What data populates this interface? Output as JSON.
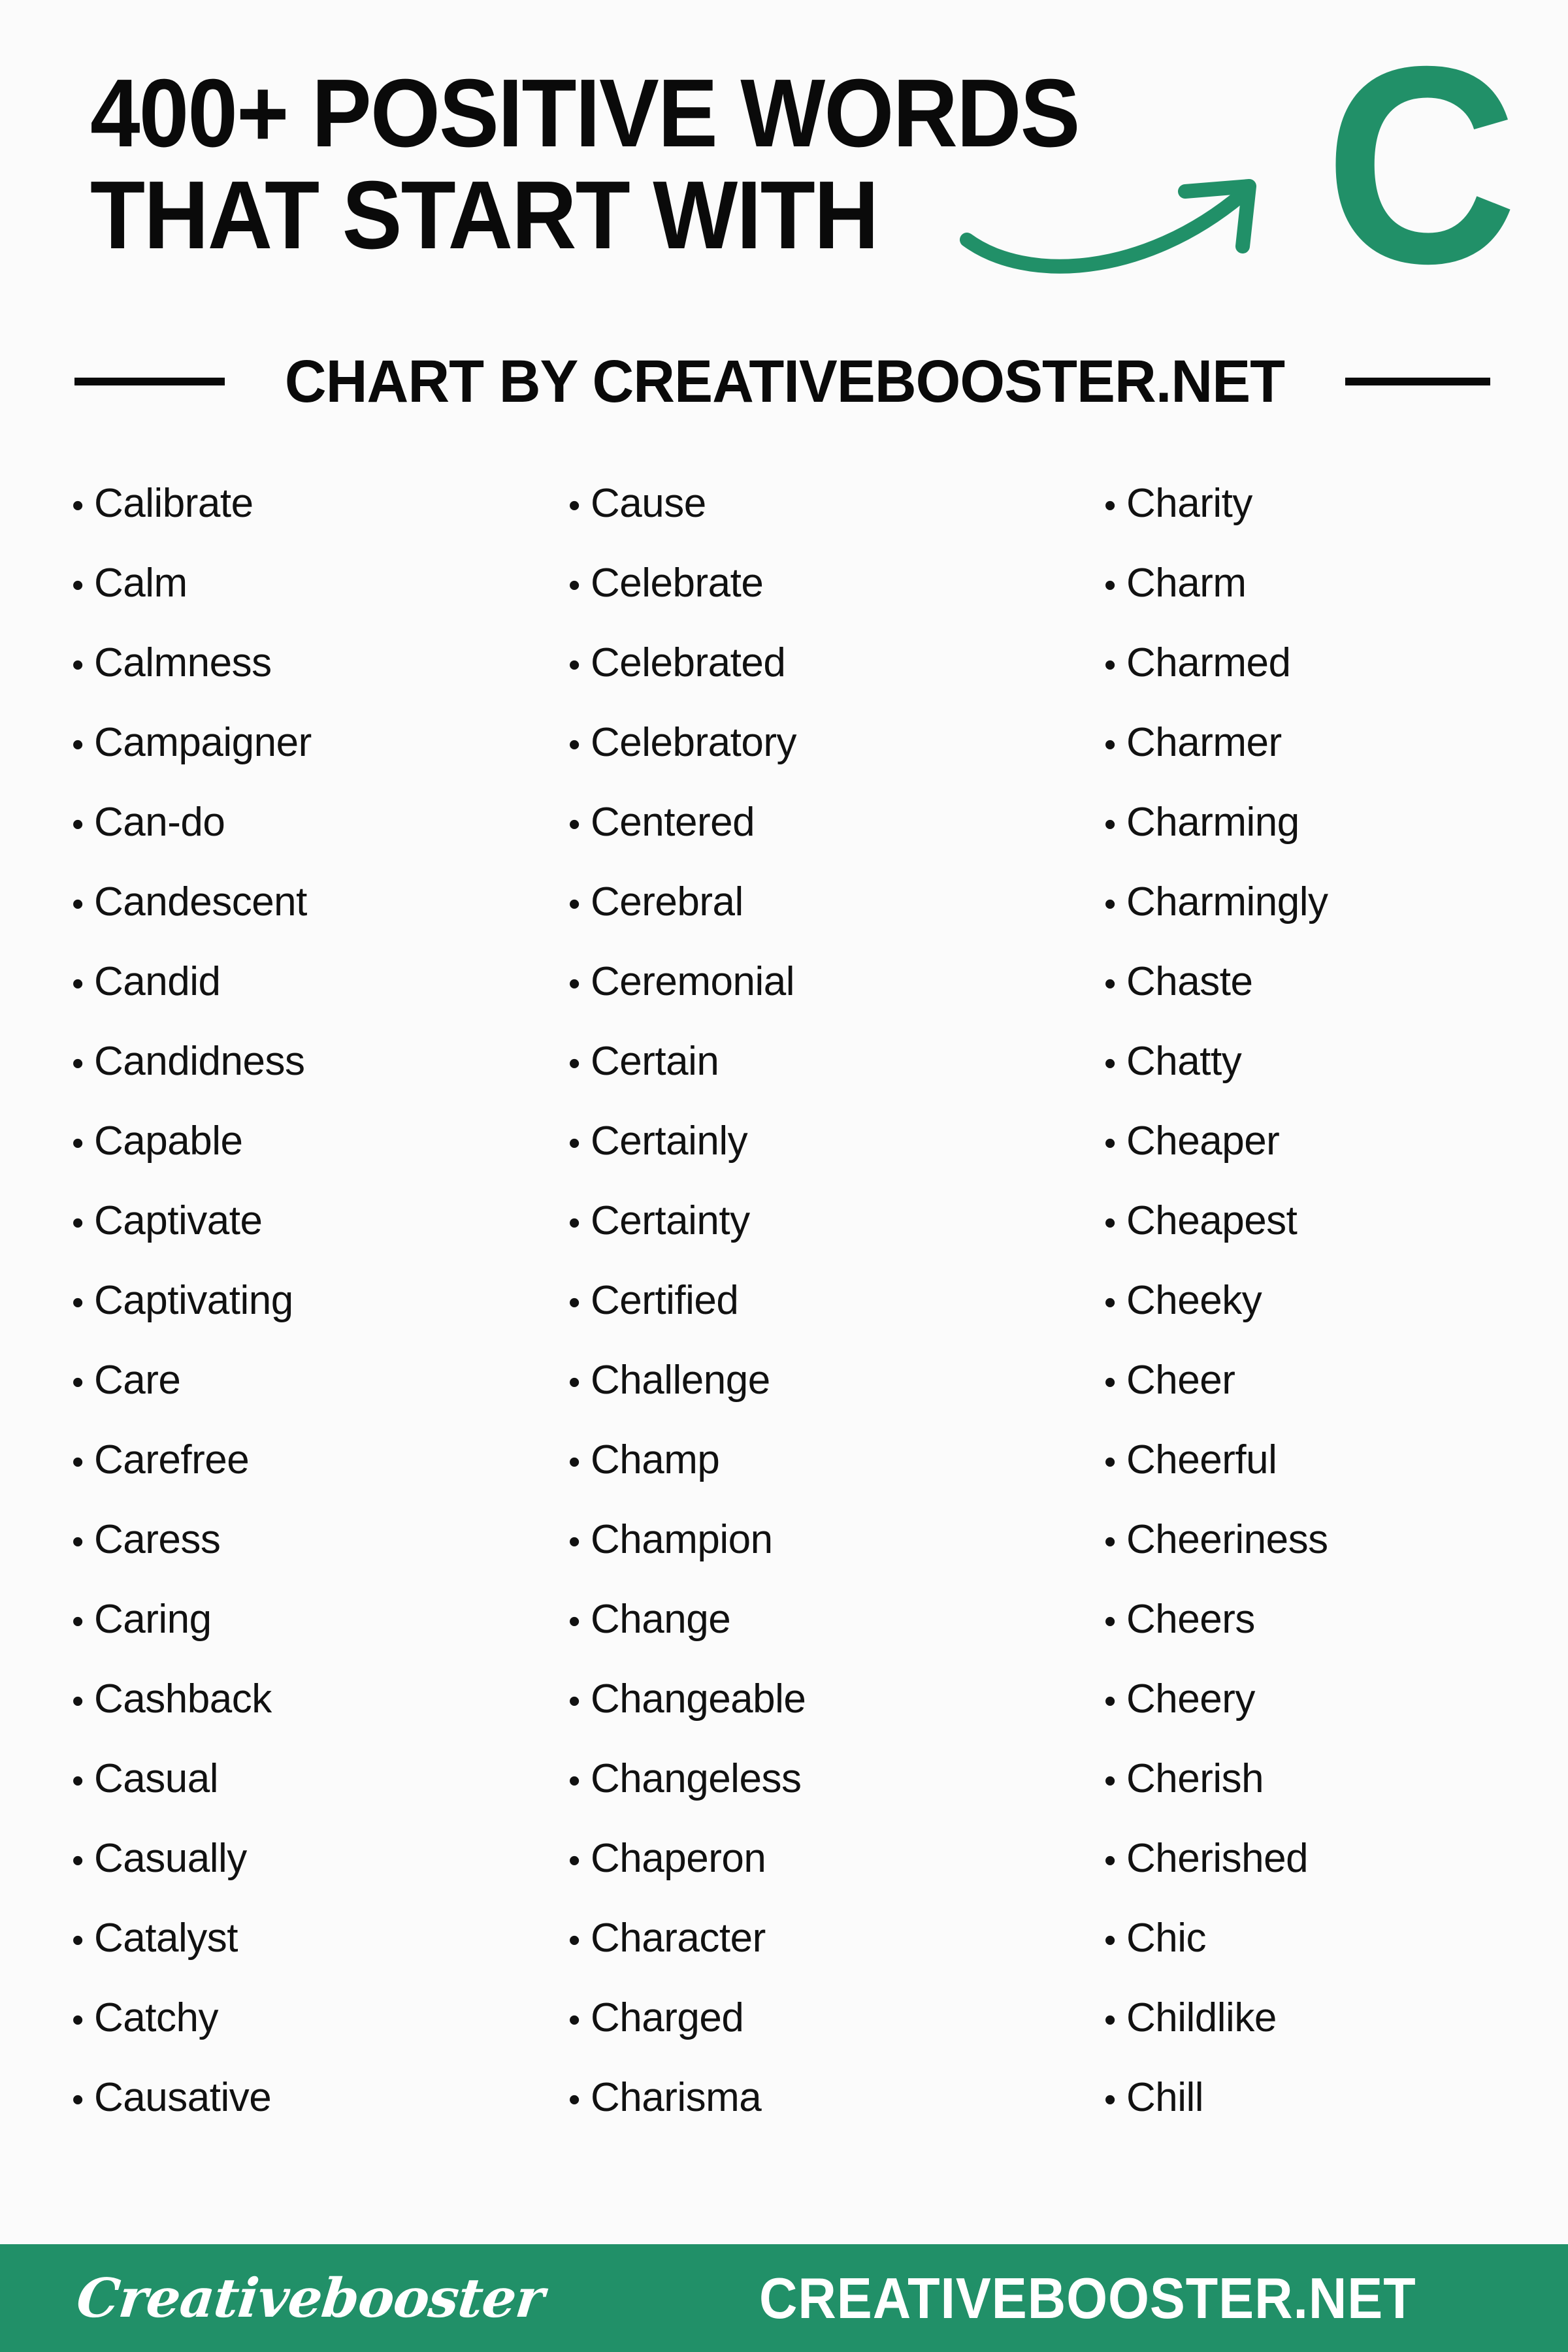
{
  "page": {
    "background_color": "#fbfbfb",
    "accent_color": "#219068",
    "text_color": "#111111"
  },
  "header": {
    "title_line1": "400+ POSITIVE WORDS",
    "title_line2": "THAT START WITH",
    "letter_badge": "C",
    "subtitle": "CHART BY CREATIVEBOOSTER.NET"
  },
  "columns": [
    {
      "id": "column-1",
      "words": [
        "Calibrate",
        "Calm",
        "Calmness",
        "Campaigner",
        "Can-do",
        "Candescent",
        "Candid",
        "Candidness",
        "Capable",
        "Captivate",
        "Captivating",
        "Care",
        "Carefree",
        "Caress",
        "Caring",
        "Cashback",
        "Casual",
        "Casually",
        "Catalyst",
        "Catchy",
        "Causative"
      ]
    },
    {
      "id": "column-2",
      "words": [
        "Cause",
        "Celebrate",
        "Celebrated",
        "Celebratory",
        "Centered",
        "Cerebral",
        "Ceremonial",
        "Certain",
        "Certainly",
        "Certainty",
        "Certified",
        "Challenge",
        "Champ",
        "Champion",
        "Change",
        "Changeable",
        "Changeless",
        "Chaperon",
        "Character",
        "Charged",
        "Charisma"
      ]
    },
    {
      "id": "column-3",
      "words": [
        "Charity",
        "Charm",
        "Charmed",
        "Charmer",
        "Charming",
        "Charmingly",
        "Chaste",
        "Chatty",
        "Cheaper",
        "Cheapest",
        "Cheeky",
        "Cheer",
        "Cheerful",
        "Cheeriness",
        "Cheers",
        "Cheery",
        "Cherish",
        "Cherished",
        "Chic",
        "Childlike",
        "Chill"
      ]
    }
  ],
  "footer": {
    "logo_text": "Creativebooster",
    "url_text": "CREATIVEBOOSTER.NET"
  },
  "icons": {
    "bullet": "•",
    "arrow": "curved-arrow-icon"
  }
}
